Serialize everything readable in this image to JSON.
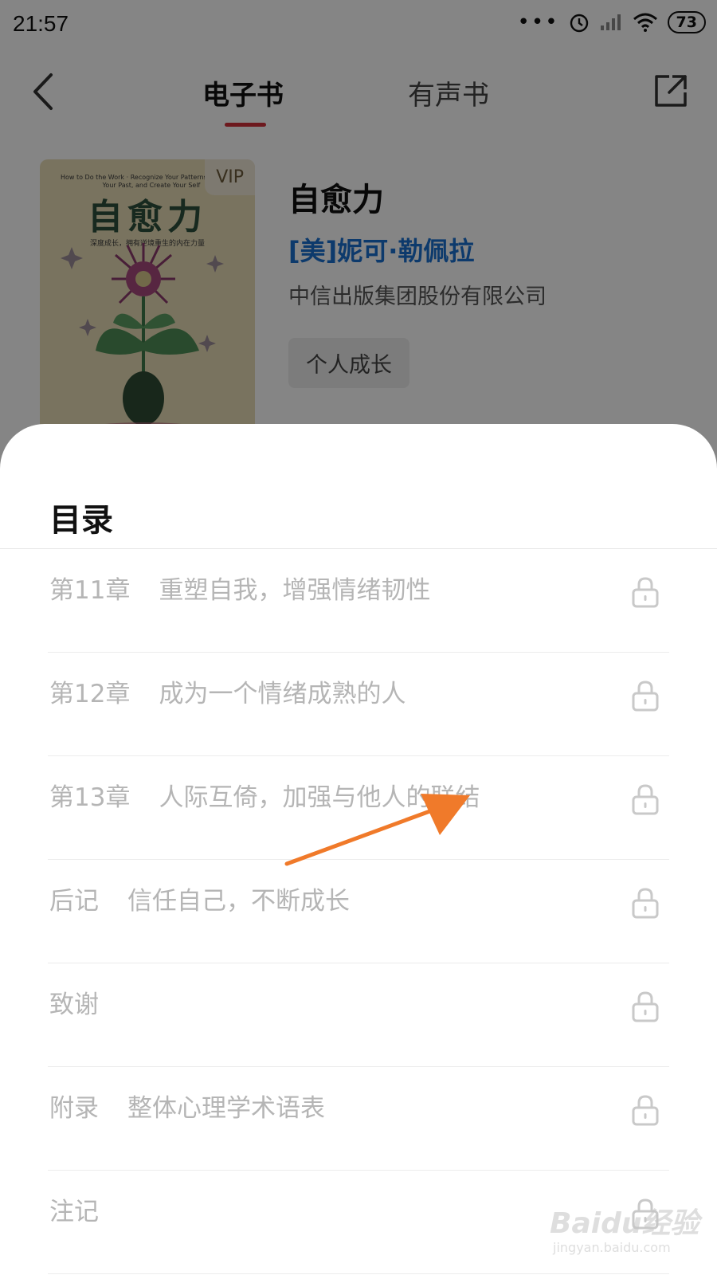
{
  "status_bar": {
    "time": "21:57",
    "battery": "73"
  },
  "top_bar": {
    "tabs": [
      {
        "label": "电子书",
        "active": true
      },
      {
        "label": "有声书",
        "active": false
      }
    ]
  },
  "book": {
    "vip_badge": "VIP",
    "cover_subtitle": "How to Do the Work · Recognize Your Patterns, Heal from Your Past, and Create Your Self",
    "cover_title": "自愈力",
    "cover_tagline": "深度成长，拥有逆境重生的内在力量",
    "title": "自愈力",
    "author": "[美]妮可·勒佩拉",
    "publisher": "中信出版集团股份有限公司",
    "category_tag": "个人成长"
  },
  "toc_sheet": {
    "title": "目录",
    "items": [
      {
        "chapter": "第11章",
        "name": "重塑自我，增强情绪韧性"
      },
      {
        "chapter": "第12章",
        "name": "成为一个情绪成熟的人"
      },
      {
        "chapter": "第13章",
        "name": "人际互倚，加强与他人的联结"
      },
      {
        "chapter": "后记",
        "name": "信任自己，不断成长"
      },
      {
        "chapter": "致谢",
        "name": ""
      },
      {
        "chapter": "附录",
        "name": "整体心理学术语表"
      },
      {
        "chapter": "注记",
        "name": ""
      }
    ]
  },
  "watermark": {
    "main": "Baidu经验",
    "sub": "jingyan.baidu.com"
  },
  "colors": {
    "accent_red": "#d2313a",
    "author_blue": "#1a6fd0",
    "annotation_arrow": "#f07a2a"
  },
  "icons": {
    "back": "chevron-left-icon",
    "share": "share-icon",
    "lock": "lock-icon"
  }
}
